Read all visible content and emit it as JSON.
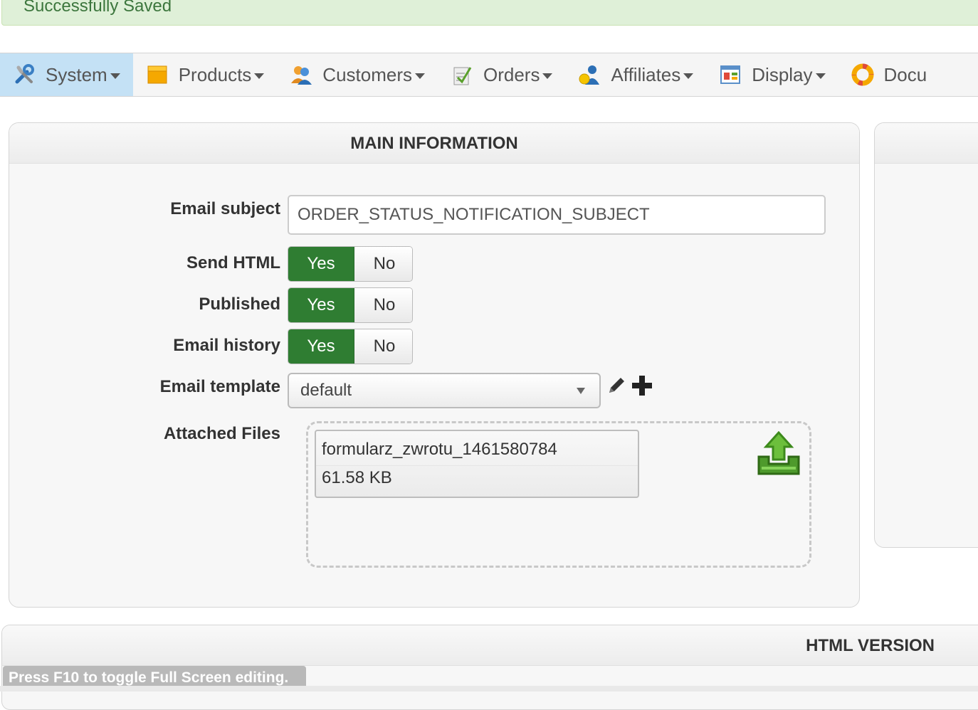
{
  "alert": {
    "text": "Successfully Saved",
    "color": "#3c763d"
  },
  "menu": {
    "items": [
      {
        "label": "System",
        "icon": "tools-icon",
        "active": true
      },
      {
        "label": "Products",
        "icon": "box-icon"
      },
      {
        "label": "Customers",
        "icon": "users-icon"
      },
      {
        "label": "Orders",
        "icon": "clipboard-icon"
      },
      {
        "label": "Affiliates",
        "icon": "affiliates-icon"
      },
      {
        "label": "Display",
        "icon": "display-window-icon"
      },
      {
        "label": "Docu",
        "icon": "lifebuoy-icon"
      }
    ]
  },
  "main": {
    "title": "MAIN INFORMATION",
    "email_subject_label": "Email subject",
    "email_subject_value": "ORDER_STATUS_NOTIFICATION_SUBJECT",
    "send_html_label": "Send HTML",
    "published_label": "Published",
    "email_history_label": "Email history",
    "yes_label": "Yes",
    "no_label": "No",
    "email_template_label": "Email template",
    "email_template_value": "default",
    "attached_files_label": "Attached Files",
    "file": {
      "name": "formularz_zwrotu_1461580784",
      "size": "61.58 KB"
    }
  },
  "html_section": {
    "title": "HTML VERSION"
  },
  "editor_hint": "Press F10 to toggle Full Screen editing.",
  "colors": {
    "accent_green": "#2f7d32",
    "menu_active": "#c4e1f5",
    "alert_bg": "#dff0d8"
  }
}
